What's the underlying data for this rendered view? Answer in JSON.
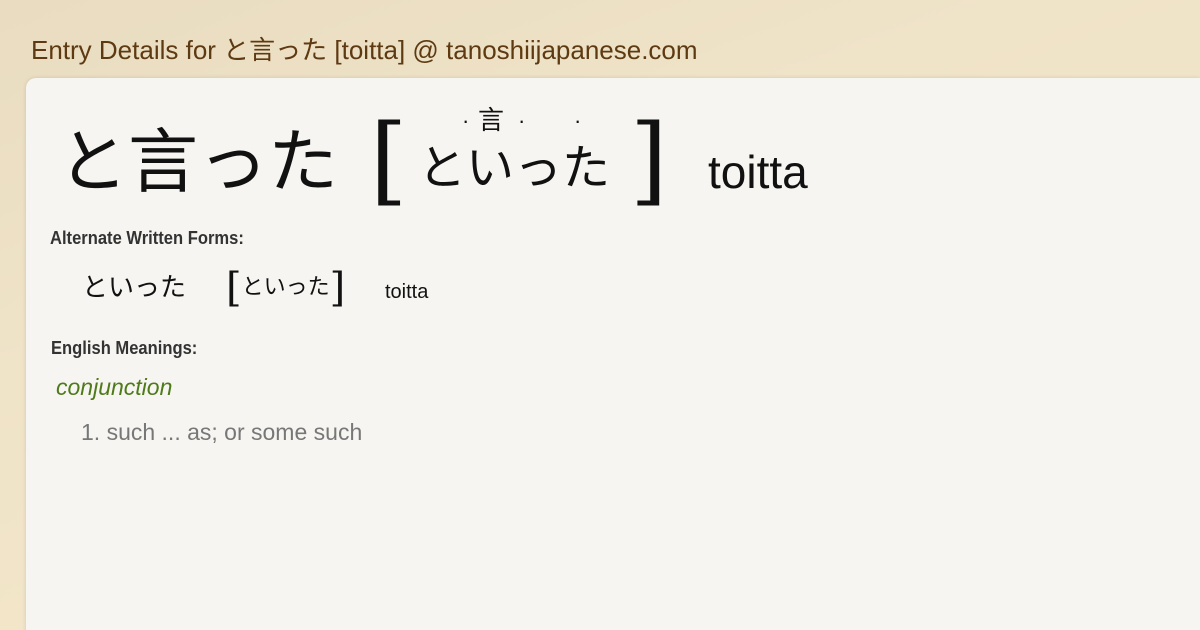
{
  "page": {
    "title": "Entry Details for と言った [toitta] @ tanoshiijapanese.com"
  },
  "entry": {
    "headword": "と言った",
    "reading": "といった",
    "ruby": "言",
    "romaji": "toitta",
    "bracket_open": "[",
    "bracket_close": "]"
  },
  "alternate_forms": {
    "label": "Alternate Written Forms:",
    "items": [
      {
        "form": "といった",
        "reading": "といった",
        "romaji": "toitta"
      }
    ]
  },
  "english_meanings": {
    "label": "English Meanings:",
    "part_of_speech": "conjunction",
    "meanings": [
      "1. such ... as; or some such"
    ]
  },
  "colors": {
    "title": "#5e3a12",
    "part_of_speech": "#4f7a1a",
    "meaning_text": "#777777",
    "panel_bg": "#f6f5f1"
  }
}
